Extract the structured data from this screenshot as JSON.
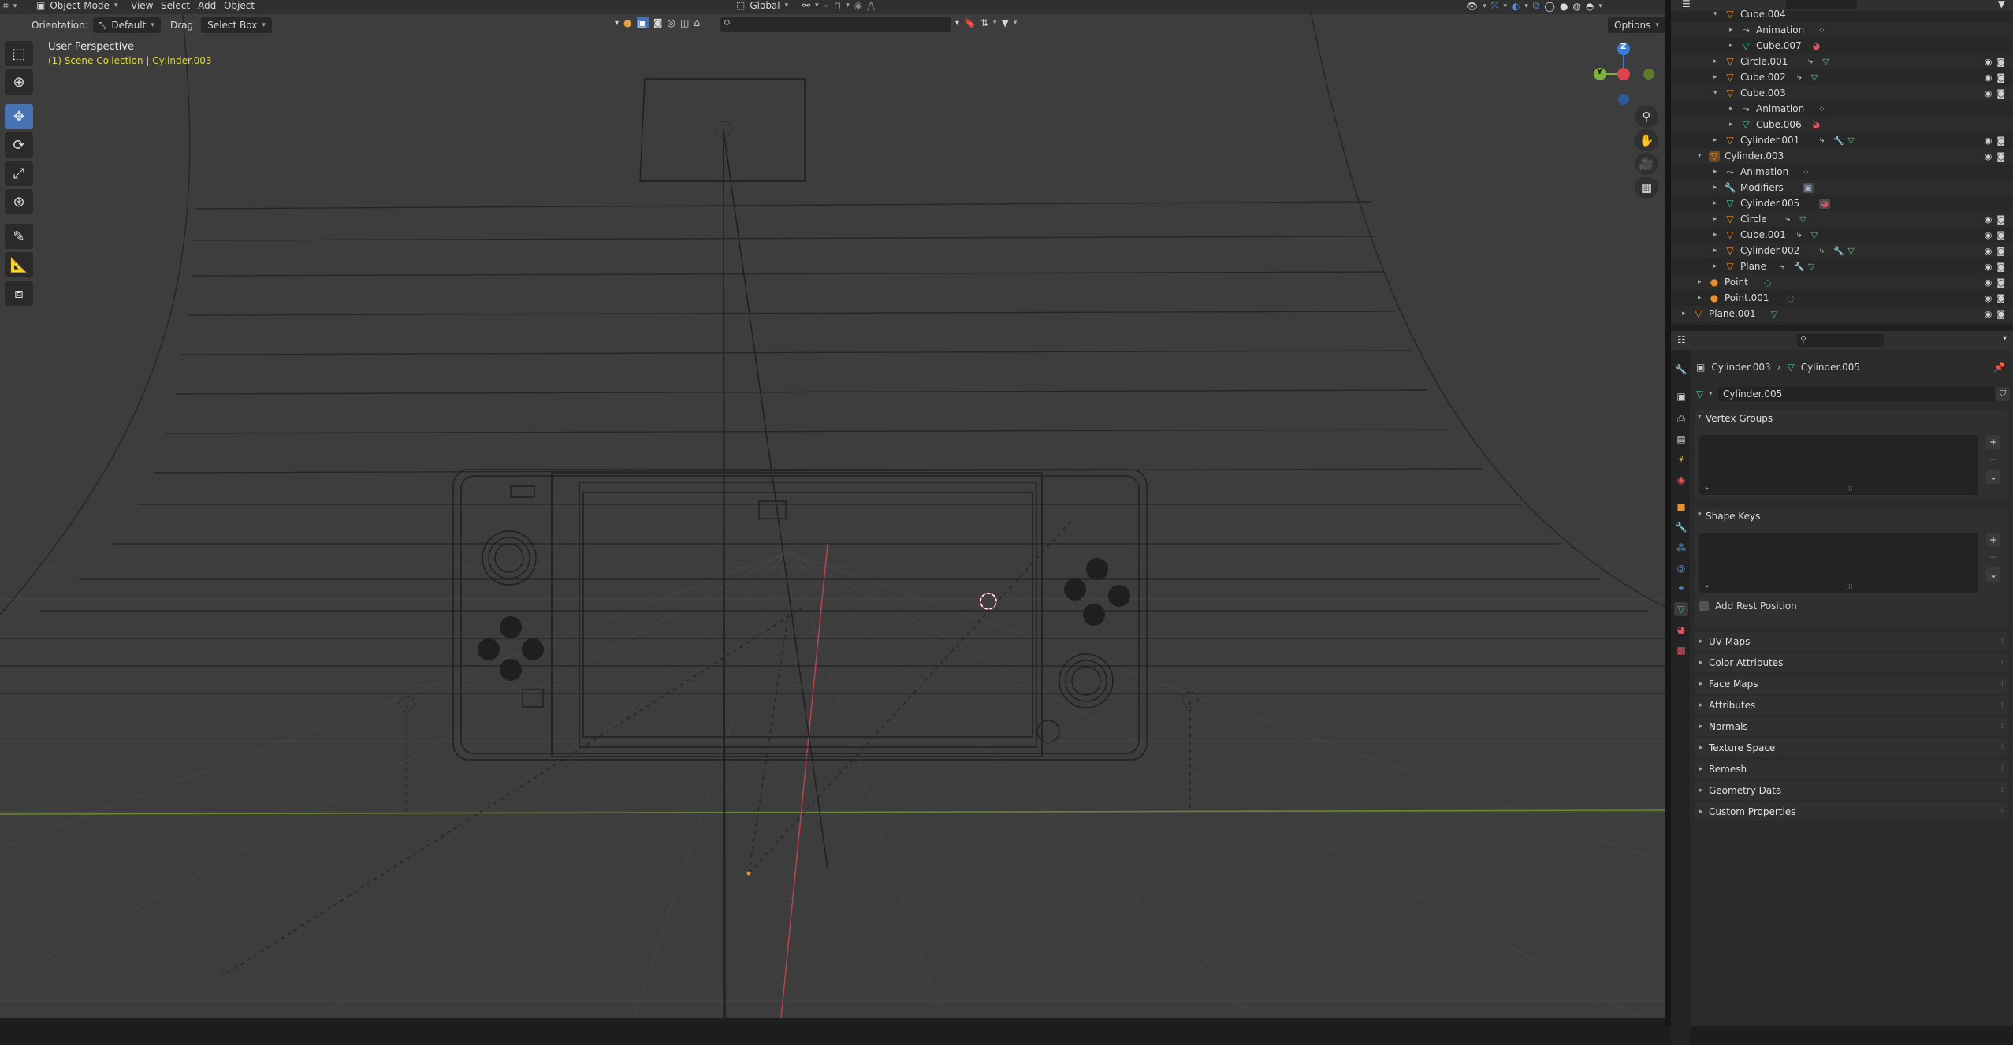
{
  "viewport": {
    "header": {
      "mode": "Object Mode",
      "menus": [
        "View",
        "Select",
        "Add",
        "Object"
      ],
      "transform_space": "Global",
      "orientation_label": "Orientation:",
      "orientation_value": "Default",
      "drag_label": "Drag:",
      "drag_value": "Select Box",
      "options": "Options"
    },
    "info_line1": "User Perspective",
    "info_line2": "(1) Scene Collection | Cylinder.003",
    "gizmo": {
      "z": "Z",
      "y": "Y"
    }
  },
  "outliner": {
    "rows": [
      {
        "label": "Cube.004",
        "type": "mesh"
      },
      {
        "label": "Animation",
        "type": "anim"
      },
      {
        "label": "Cube.007",
        "type": "meshdata"
      },
      {
        "label": "Circle.001",
        "type": "mesh"
      },
      {
        "label": "Cube.002",
        "type": "mesh"
      },
      {
        "label": "Cube.003",
        "type": "mesh"
      },
      {
        "label": "Animation",
        "type": "anim"
      },
      {
        "label": "Cube.006",
        "type": "meshdata"
      },
      {
        "label": "Cylinder.001",
        "type": "mesh"
      },
      {
        "label": "Cylinder.003",
        "type": "mesh"
      },
      {
        "label": "Animation",
        "type": "anim"
      },
      {
        "label": "Modifiers",
        "type": "mod"
      },
      {
        "label": "Cylinder.005",
        "type": "meshdata"
      },
      {
        "label": "Circle",
        "type": "mesh"
      },
      {
        "label": "Cube.001",
        "type": "mesh"
      },
      {
        "label": "Cylinder.002",
        "type": "mesh"
      },
      {
        "label": "Plane",
        "type": "mesh"
      },
      {
        "label": "Point",
        "type": "light"
      },
      {
        "label": "Point.001",
        "type": "light"
      },
      {
        "label": "Plane.001",
        "type": "mesh"
      }
    ]
  },
  "properties": {
    "breadcrumb_object": "Cylinder.003",
    "breadcrumb_data": "Cylinder.005",
    "data_name": "Cylinder.005",
    "panels": {
      "vertex_groups": "Vertex Groups",
      "shape_keys": "Shape Keys",
      "add_rest_position": "Add Rest Position"
    },
    "collapsed": [
      "UV Maps",
      "Color Attributes",
      "Face Maps",
      "Attributes",
      "Normals",
      "Texture Space",
      "Remesh",
      "Geometry Data",
      "Custom Properties"
    ]
  },
  "colors": {
    "viewport_bg": "#3d3d3d",
    "accent": "#4772b3",
    "x_axis": "#e0424a",
    "y_axis": "#7fb039",
    "z_axis": "#3b7bd4",
    "mesh_icon": "#e89a3c",
    "data_icon": "#42c98a",
    "selection_text": "#e0d83a"
  }
}
